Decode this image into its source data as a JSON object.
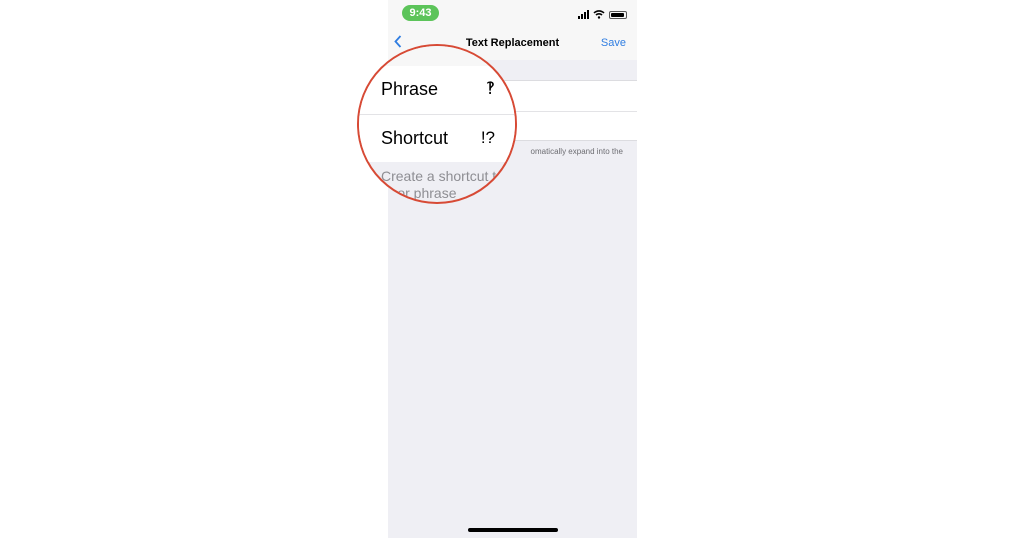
{
  "status_bar": {
    "time": "9:43"
  },
  "nav": {
    "back_label": "",
    "title": "Text Replacement",
    "save_label": "Save"
  },
  "form": {
    "phrase_label": "Phrase",
    "phrase_value": "‽",
    "shortcut_label": "Shortcut",
    "shortcut_value": "!?"
  },
  "footer": {
    "visible_fragment": "omatically expand into the",
    "magnified_line1": "Create a shortcut t",
    "magnified_line2": "rd or phrase"
  },
  "colors": {
    "accent": "#2f7de1",
    "magnifier_ring": "#d74a35",
    "time_pill": "#5cc45a"
  }
}
